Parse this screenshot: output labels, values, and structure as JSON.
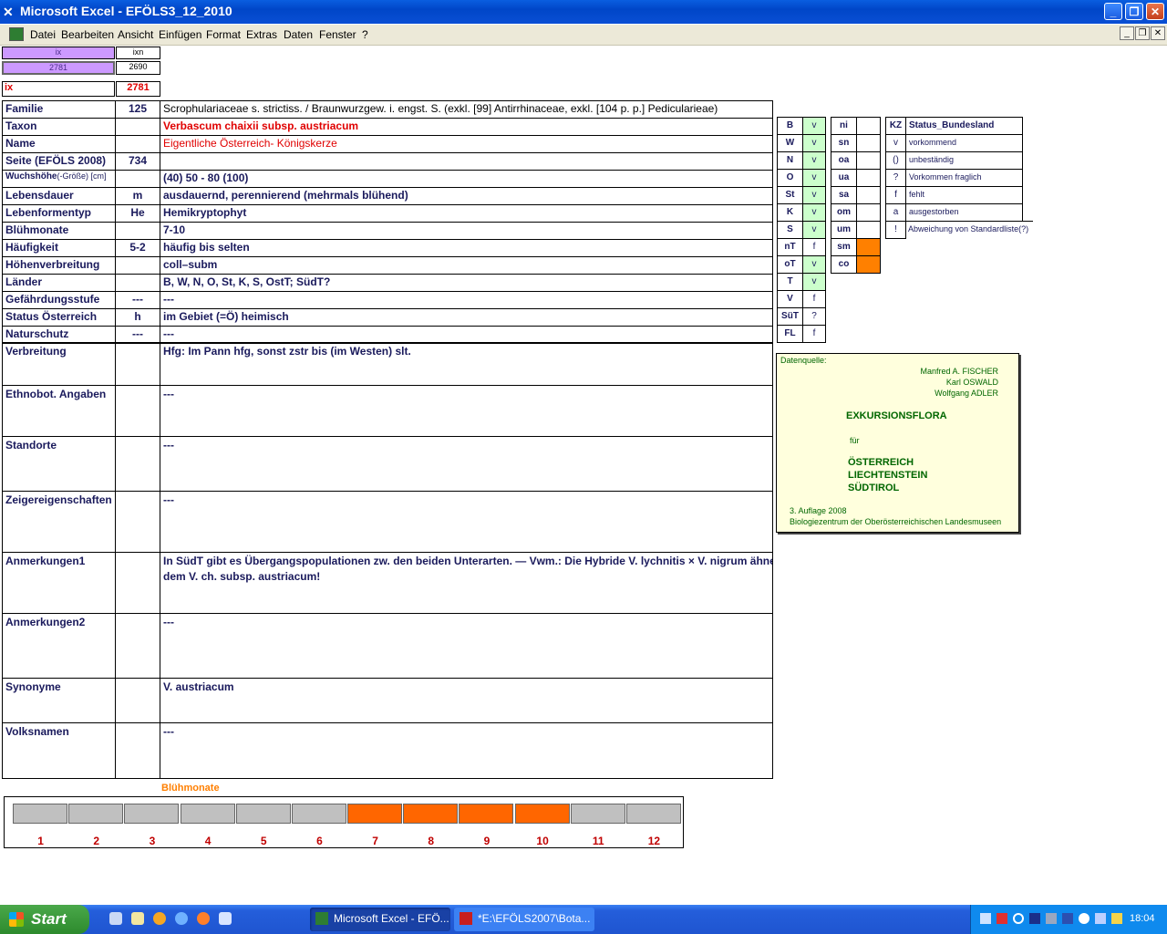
{
  "window": {
    "title": "Microsoft Excel - EFÖLS3_12_2010"
  },
  "menu": [
    "Datei",
    "Bearbeiten",
    "Ansicht",
    "Einfügen",
    "Format",
    "Extras",
    "Daten",
    "Fenster",
    "?"
  ],
  "top_cells": {
    "ix_header": "ix",
    "ixn_header": "ixn",
    "ix_value": "2781",
    "ixn_value": "2690",
    "ix_label": "ix",
    "ix_label_value": "2781"
  },
  "rows": [
    {
      "label": "Familie",
      "code": "125",
      "value": "Scrophulariaceae s. strictiss.  /  Braunwurzgew. i. engst. S. (exkl. [99] Antirrhinaceae, exkl. [104 p. p.] Pedicularieae)"
    },
    {
      "label": "Taxon",
      "code": "",
      "value": "Verbascum chaixii subsp. austriacum"
    },
    {
      "label": "Name",
      "code": "",
      "value": "Eigentliche Österreich- Königskerze"
    },
    {
      "label": "Seite (EFÖLS 2008)",
      "code": "734",
      "value": ""
    },
    {
      "label": "Wuchshöhe",
      "label_suffix": "(-Größe) [cm]",
      "code": "",
      "value": "(40) 50 - 80 (100)"
    },
    {
      "label": "Lebensdauer",
      "code": "m",
      "value": "ausdauernd, perennierend (mehrmals blühend)"
    },
    {
      "label": "Lebenformentyp",
      "code": "He",
      "value": "Hemikryptophyt"
    },
    {
      "label": "Blühmonate",
      "code": "",
      "value": "7-10"
    },
    {
      "label": "Häufigkeit",
      "code": "5-2",
      "value": "häufig bis selten"
    },
    {
      "label": "Höhenverbreitung",
      "code": "",
      "value": "coll–subm"
    },
    {
      "label": "Länder",
      "code": "",
      "value": "B, W, N, O, St, K, S, OstT; SüdT?"
    },
    {
      "label": "Gefährdungsstufe",
      "code": "---",
      "value": "---"
    },
    {
      "label": "Status Österreich",
      "code": "h",
      "value": "im Gebiet (=Ö) heimisch"
    },
    {
      "label": "Naturschutz",
      "code": "---",
      "value": "---"
    }
  ],
  "big_rows": [
    {
      "label": "Verbreitung",
      "value": "Hfg: Im Pann hfg, sonst zstr bis (im Westen) slt.",
      "value2": ""
    },
    {
      "label": "Ethnobot. Angaben",
      "value": "---",
      "value2": ""
    },
    {
      "label": "Standorte",
      "value": "---",
      "value2": ""
    },
    {
      "label": "Zeigereigenschaften",
      "value": "---",
      "value2": ""
    },
    {
      "label": "Anmerkungen1",
      "value": "In SüdT gibt es Übergangspopulationen zw. den beiden Unterarten. — Vwm.: Die Hybride V. lychnitis × V. nigrum ähnelt",
      "value2": "dem V. ch. subsp. austriacum!"
    },
    {
      "label": "Anmerkungen2",
      "value": "---",
      "value2": ""
    },
    {
      "label": "Synonyme",
      "value": "V. austriacum",
      "value2": ""
    },
    {
      "label": "Volksnamen",
      "value": "---",
      "value2": ""
    }
  ],
  "regions": [
    {
      "code": "B",
      "status": "v"
    },
    {
      "code": "W",
      "status": "v"
    },
    {
      "code": "N",
      "status": "v"
    },
    {
      "code": "O",
      "status": "v"
    },
    {
      "code": "St",
      "status": "v"
    },
    {
      "code": "K",
      "status": "v"
    },
    {
      "code": "S",
      "status": "v"
    },
    {
      "code": "nT",
      "status": "f"
    },
    {
      "code": "oT",
      "status": "v"
    },
    {
      "code": "T",
      "status": "v"
    },
    {
      "code": "V",
      "status": "f"
    },
    {
      "code": "SüT",
      "status": "?"
    },
    {
      "code": "FL",
      "status": "f"
    }
  ],
  "altitude": [
    {
      "code": "ni",
      "on": false
    },
    {
      "code": "sn",
      "on": false
    },
    {
      "code": "oa",
      "on": false
    },
    {
      "code": "ua",
      "on": false
    },
    {
      "code": "sa",
      "on": false
    },
    {
      "code": "om",
      "on": false
    },
    {
      "code": "um",
      "on": false
    },
    {
      "code": "sm",
      "on": true
    },
    {
      "code": "co",
      "on": true
    }
  ],
  "legend": {
    "header_kz": "KZ",
    "header_title": "Status_Bundesland",
    "items": [
      {
        "kz": "v",
        "text": "vorkommend"
      },
      {
        "kz": "()",
        "text": "unbeständig"
      },
      {
        "kz": "?",
        "text": "Vorkommen fraglich"
      },
      {
        "kz": "f",
        "text": "fehlt"
      },
      {
        "kz": "a",
        "text": "ausgestorben"
      },
      {
        "kz": "!",
        "text": "Abweichung von Standardliste(?)"
      }
    ]
  },
  "source": {
    "label": "Datenquelle:",
    "authors": [
      "Manfred A. FISCHER",
      "Karl OSWALD",
      "Wolfgang ADLER"
    ],
    "title": "EXKURSIONSFLORA",
    "fuer": "für",
    "countries": [
      "ÖSTERREICH",
      "LIECHTENSTEIN",
      "SÜDTIROL"
    ],
    "edition": "3. Auflage 2008",
    "publisher": "Biologiezentrum der Oberösterreichischen Landesmuseen"
  },
  "bloom": {
    "title": "Blühmonate",
    "months": [
      "1",
      "2",
      "3",
      "4",
      "5",
      "6",
      "7",
      "8",
      "9",
      "10",
      "11",
      "12"
    ],
    "active": [
      false,
      false,
      false,
      false,
      false,
      false,
      true,
      true,
      true,
      true,
      false,
      false
    ],
    "active_color": "#ff6600",
    "inactive_color": "#c0c0c0"
  },
  "taskbar": {
    "start": "Start",
    "tasks": [
      "Microsoft Excel - EFÖ...",
      "*E:\\EFÖLS2007\\Bota..."
    ],
    "clock": "18:04"
  },
  "colors": {
    "label_text": "#1a1a5c",
    "taxon_red": "#e00000",
    "ix_purple": "#cc99ff",
    "green_cell": "#ccffcc",
    "orange_cell": "#ff8000",
    "source_bg": "#ffffdd",
    "source_green": "#006600"
  }
}
